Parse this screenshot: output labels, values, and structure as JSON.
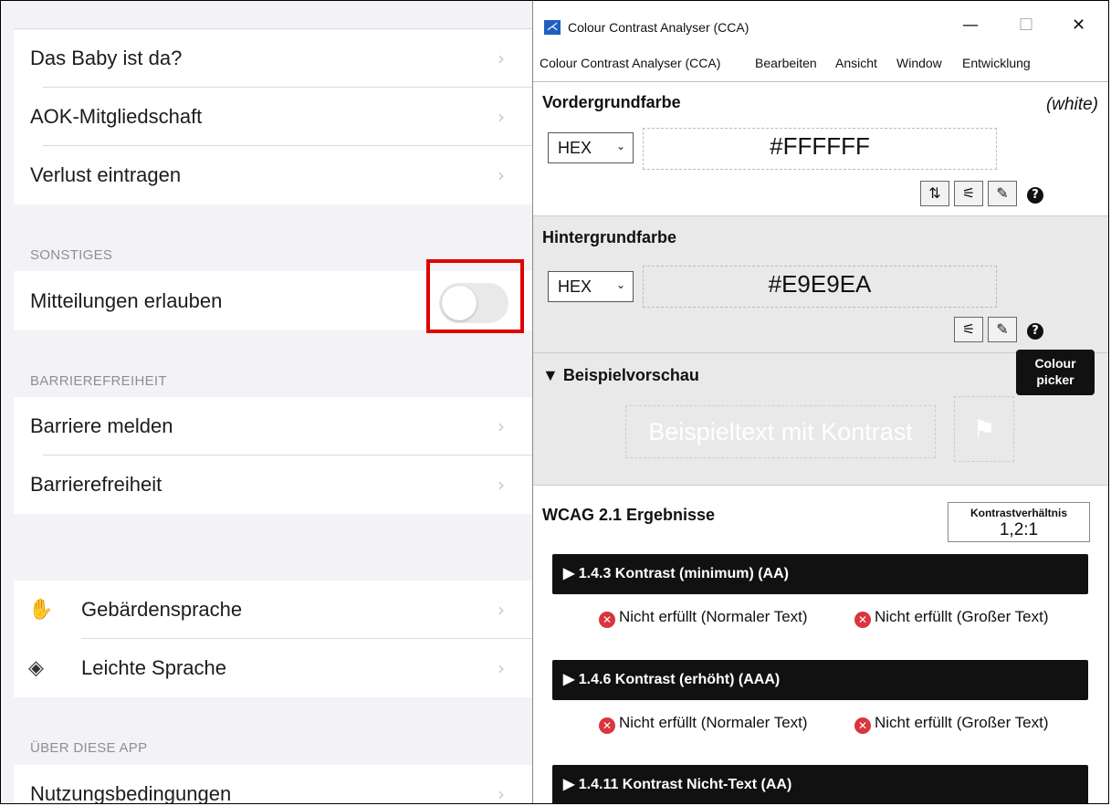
{
  "ios_settings": {
    "rows_top": [
      {
        "label": "Das Baby ist da?"
      },
      {
        "label": "AOK-Mitgliedschaft"
      },
      {
        "label": "Verlust eintragen"
      }
    ],
    "section_sonstiges": "SONSTIGES",
    "notifications_label": "Mitteilungen erlauben",
    "notifications_toggle_on": false,
    "section_barriere": "BARRIEREFREIHEIT",
    "rows_barriere": [
      {
        "label": "Barriere melden"
      },
      {
        "label": "Barrierefreiheit"
      }
    ],
    "rows_language": [
      {
        "label": "Gebärdensprache",
        "icon": "sign-language-hand-icon"
      },
      {
        "label": "Leichte Sprache",
        "icon": "easy-language-icon"
      }
    ],
    "section_about": "ÜBER DIESE APP",
    "rows_about": [
      {
        "label": "Nutzungsbedingungen"
      }
    ],
    "chevron": "›",
    "highlight_color": "#e00000"
  },
  "cca": {
    "window_title": "Colour Contrast Analyser (CCA)",
    "menu": [
      "Colour Contrast Analyser (CCA)",
      "Bearbeiten",
      "Ansicht",
      "Window",
      "Entwicklung"
    ],
    "foreground": {
      "heading": "Vordergrundfarbe",
      "color_name": "(white)",
      "format": "HEX",
      "value": "#FFFFFF"
    },
    "background": {
      "heading": "Hintergrundfarbe",
      "format": "HEX",
      "value": "#E9E9EA"
    },
    "tooltip": "Colour picker",
    "preview": {
      "heading": "▼ Beispielvorschau",
      "sample_text": "Beispieltext mit Kontrast"
    },
    "results": {
      "heading": "WCAG 2.1 Ergebnisse",
      "ratio_label": "Kontrastverhältnis",
      "ratio_value": "1,2:1",
      "criteria": [
        {
          "label": "▶ 1.4.3 Kontrast (minimum) (AA)",
          "normal": "Nicht erfüllt (Normaler Text)",
          "large": "Nicht erfüllt (Großer Text)"
        },
        {
          "label": "▶ 1.4.6 Kontrast (erhöht) (AAA)",
          "normal": "Nicht erfüllt (Normaler Text)",
          "large": "Nicht erfüllt (Großer Text)"
        },
        {
          "label": "▶ 1.4.11 Kontrast Nicht-Text (AA)"
        }
      ]
    }
  }
}
